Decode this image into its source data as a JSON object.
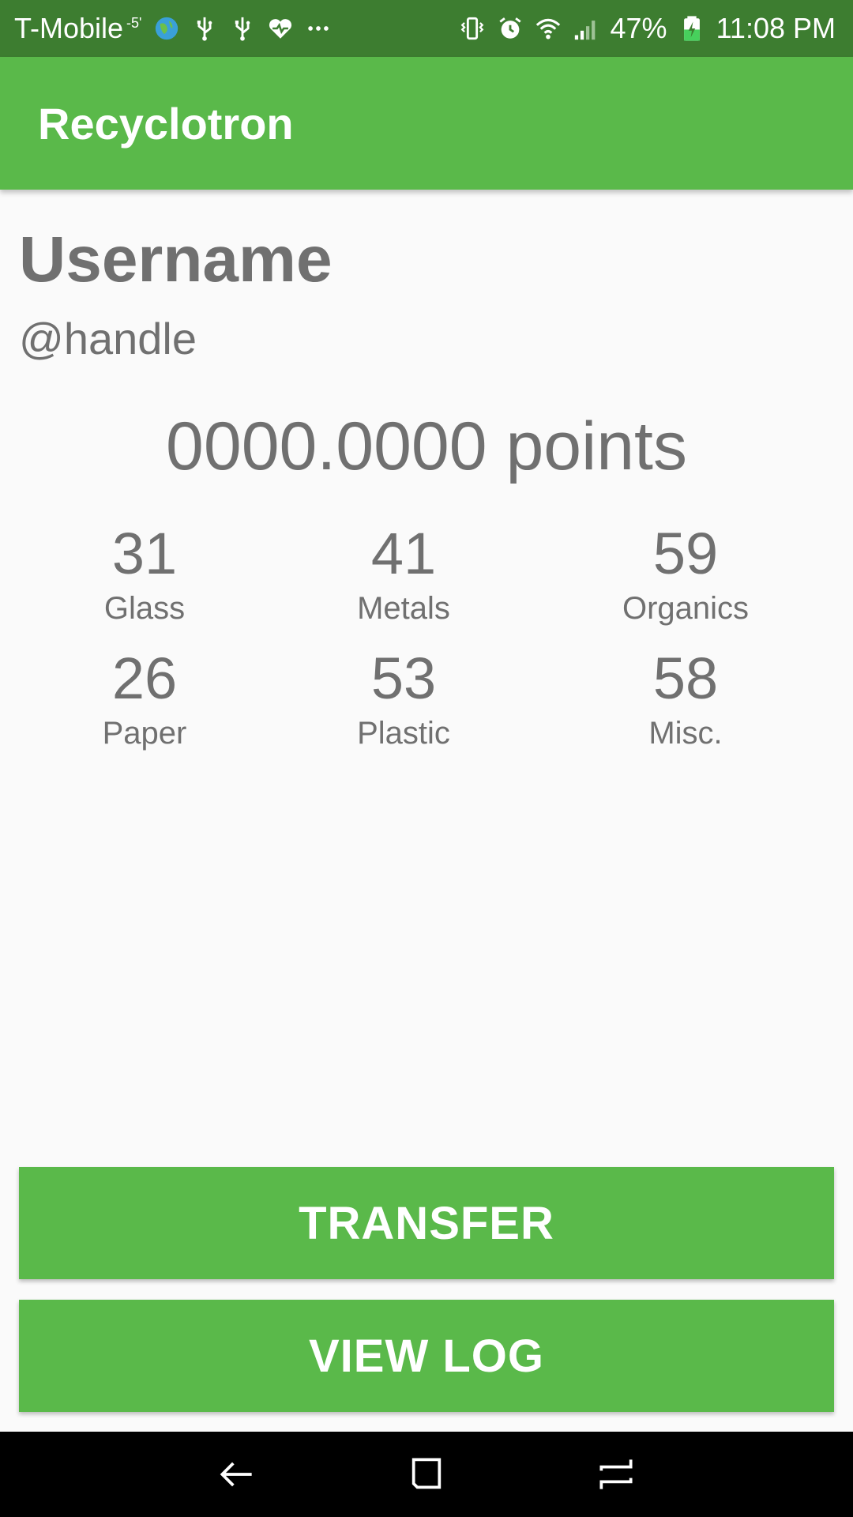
{
  "status_bar": {
    "carrier": "T-Mobile",
    "carrier_sup": "-5'",
    "battery": "47%",
    "time": "11:08 PM",
    "left_icons": [
      "globe-icon",
      "usb-icon",
      "usb-icon",
      "health-heart-icon",
      "more-dots-icon"
    ],
    "right_icons": [
      "vibrate-icon",
      "alarm-icon",
      "wifi-icon",
      "signal-icon",
      "battery-charging-icon"
    ]
  },
  "app_bar": {
    "title": "Recyclotron"
  },
  "profile": {
    "username": "Username",
    "handle": "@handle",
    "points": "0000.0000 points"
  },
  "stats": [
    {
      "value": "31",
      "label": "Glass"
    },
    {
      "value": "41",
      "label": "Metals"
    },
    {
      "value": "59",
      "label": "Organics"
    },
    {
      "value": "26",
      "label": "Paper"
    },
    {
      "value": "53",
      "label": "Plastic"
    },
    {
      "value": "58",
      "label": "Misc."
    }
  ],
  "buttons": {
    "transfer_label": "TRANSFER",
    "view_log_label": "VIEW LOG"
  },
  "nav_bar": {
    "icons": [
      "back-icon",
      "home-icon",
      "recents-icon"
    ]
  },
  "colors": {
    "status_bar_bg": "#3d7d30",
    "accent_green": "#5ab94a",
    "text_gray": "#707070",
    "background": "#fafafa"
  }
}
